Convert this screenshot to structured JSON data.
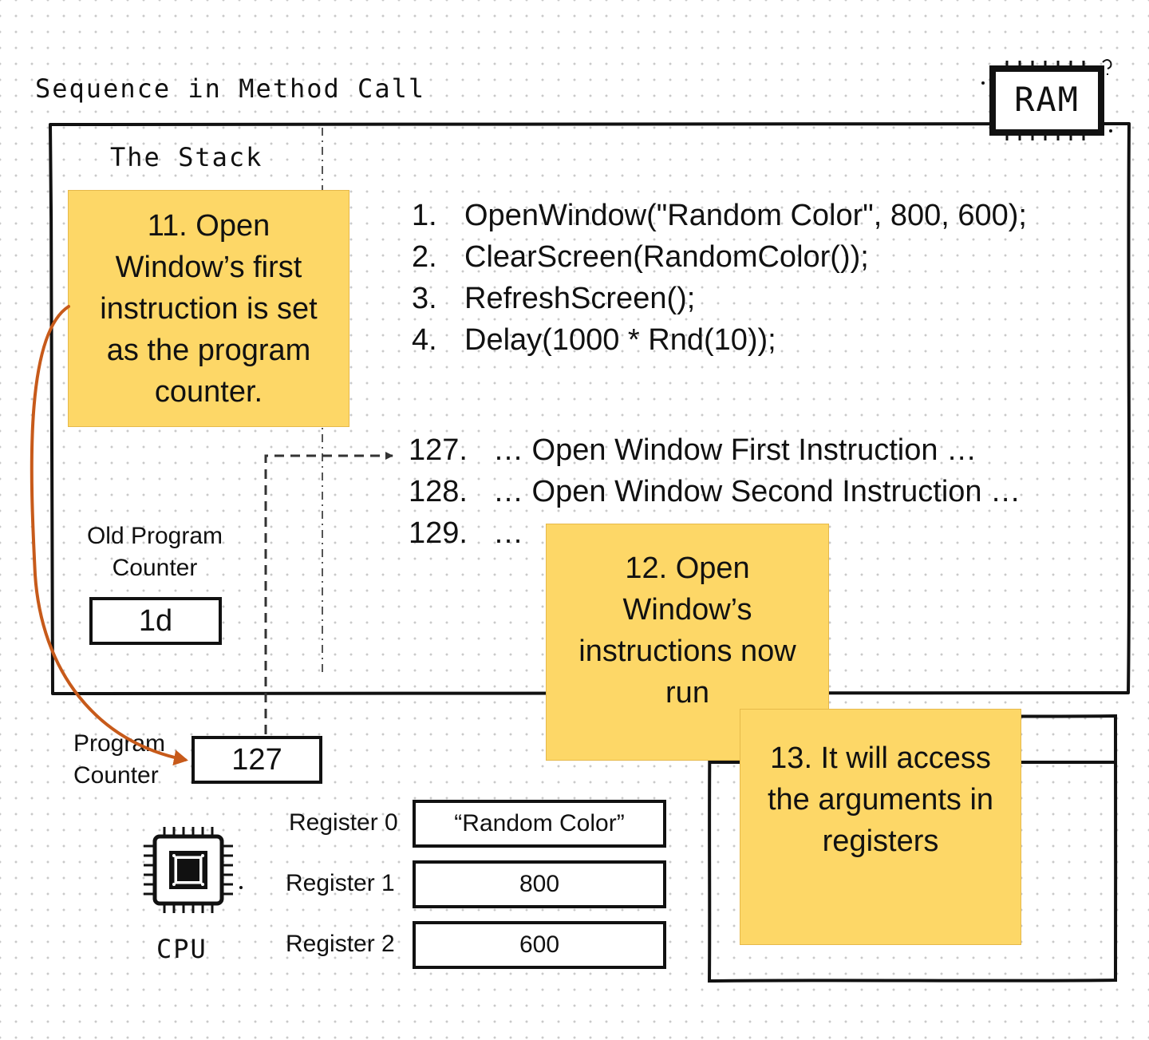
{
  "title": "Sequence in Method Call",
  "ram_label": "RAM",
  "stack_title": "The Stack",
  "notes": {
    "n11": "11. Open Window’s first instruction is set as the program counter.",
    "n12": "12. Open Window’s instructions now run",
    "n13": "13. It will access the arguments in registers"
  },
  "code_lines": [
    {
      "num": "1.",
      "text": "OpenWindow(\"Random Color\", 800, 600);"
    },
    {
      "num": "2.",
      "text": "ClearScreen(RandomColor());"
    },
    {
      "num": "3.",
      "text": "RefreshScreen();"
    },
    {
      "num": "4.",
      "text": "Delay(1000 * Rnd(10));"
    }
  ],
  "memory_lines": [
    {
      "num": "127.",
      "text": "… Open Window First Instruction …"
    },
    {
      "num": "128.",
      "text": "… Open Window Second Instruction …"
    },
    {
      "num": "129.",
      "text": "…"
    }
  ],
  "old_program_counter": {
    "label": "Old Program Counter",
    "value": "1d"
  },
  "program_counter": {
    "label": "Program Counter",
    "value": "127"
  },
  "registers": [
    {
      "label": "Register 0",
      "value": "“Random Color”"
    },
    {
      "label": "Register 1",
      "value": "800"
    },
    {
      "label": "Register 2",
      "value": "600"
    }
  ],
  "cpu_label": "CPU",
  "icons": {
    "ram": "ram-chip-icon",
    "cpu": "cpu-chip-icon"
  },
  "colors": {
    "sticky": "#fdd767",
    "arrow": "#c75a1a",
    "ink": "#111111"
  }
}
